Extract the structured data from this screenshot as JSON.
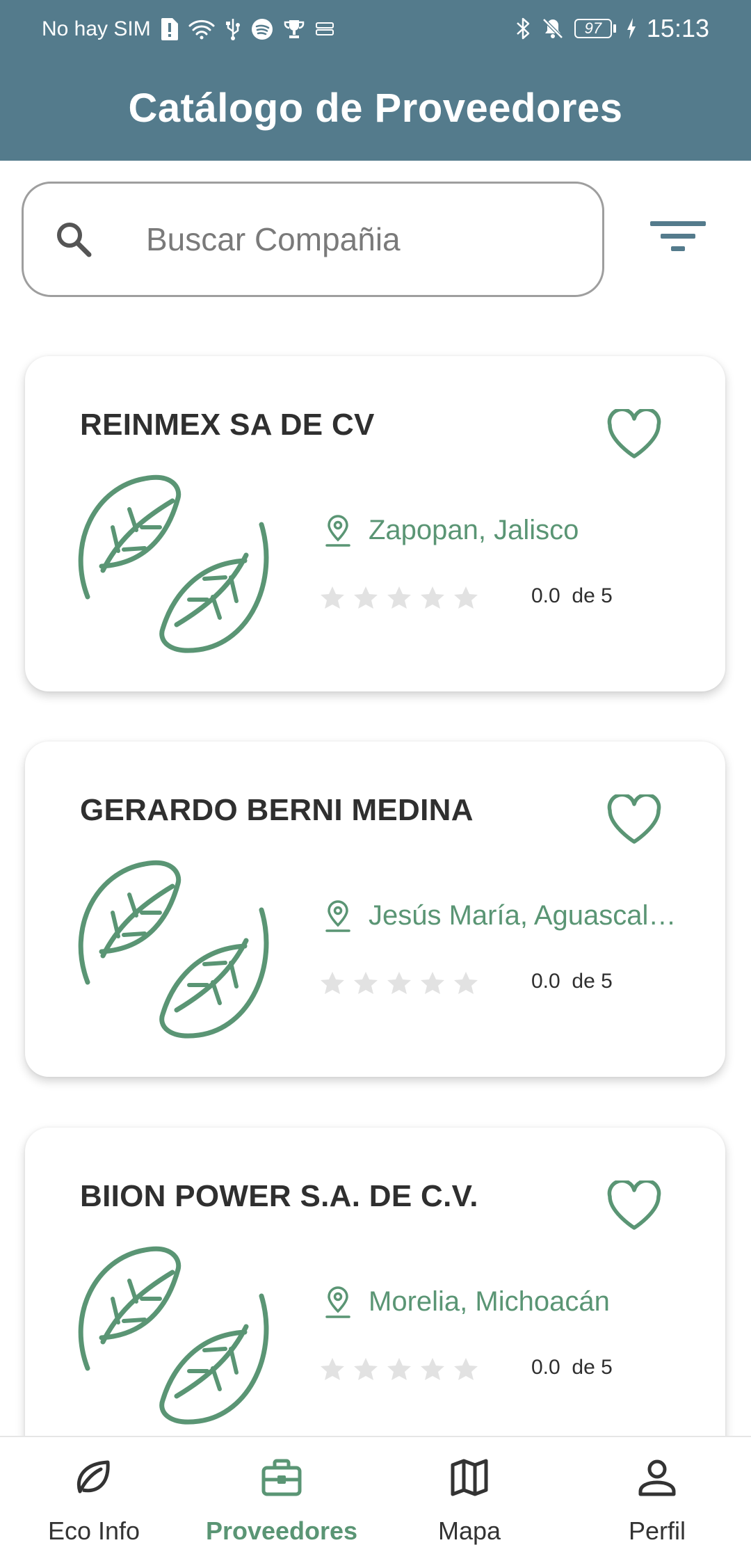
{
  "status_bar": {
    "carrier": "No hay SIM",
    "battery": "97",
    "time": "15:13"
  },
  "header": {
    "title": "Catálogo de Proveedores"
  },
  "search": {
    "placeholder": "Buscar Compañia",
    "value": ""
  },
  "colors": {
    "header": "#547b8c",
    "accent": "#5a9574",
    "star_empty": "#e2e2e2"
  },
  "providers": [
    {
      "name": "REINMEX SA DE CV",
      "location": "Zapopan, Jalisco",
      "rating": "0.0",
      "rating_suffix": "de 5",
      "stars": 0
    },
    {
      "name": "GERARDO BERNI MEDINA",
      "location": "Jesús María, Aguascali…",
      "rating": "0.0",
      "rating_suffix": "de 5",
      "stars": 0
    },
    {
      "name": "BIION POWER S.A. DE C.V.",
      "location": "Morelia, Michoacán",
      "rating": "0.0",
      "rating_suffix": "de 5",
      "stars": 0
    }
  ],
  "bottom_nav": {
    "items": [
      {
        "label": "Eco Info",
        "icon": "leaf-icon",
        "active": false
      },
      {
        "label": "Proveedores",
        "icon": "briefcase-icon",
        "active": true
      },
      {
        "label": "Mapa",
        "icon": "map-icon",
        "active": false
      },
      {
        "label": "Perfil",
        "icon": "person-icon",
        "active": false
      }
    ]
  }
}
